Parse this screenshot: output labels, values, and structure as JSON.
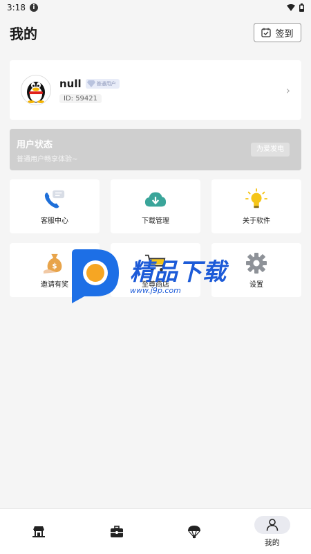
{
  "status_bar": {
    "time": "3:18"
  },
  "header": {
    "title": "我的",
    "signin_label": "签到"
  },
  "profile": {
    "username": "null",
    "badge": "普通用户",
    "user_id": "ID: 59421"
  },
  "status_banner": {
    "title": "用户状态",
    "subtitle": "普通用户畅享体验~",
    "button_label": "为爱发电"
  },
  "grid": {
    "items": [
      {
        "label": "客服中心",
        "icon": "phone-chat-icon"
      },
      {
        "label": "下载管理",
        "icon": "cloud-download-icon"
      },
      {
        "label": "关于软件",
        "icon": "lightbulb-icon"
      },
      {
        "label": "邀请有奖",
        "icon": "money-bag-icon"
      },
      {
        "label": "至尊商店",
        "icon": "shopping-cart-icon"
      },
      {
        "label": "设置",
        "icon": "gear-icon"
      }
    ]
  },
  "watermark": {
    "title": "精品下载",
    "url": "www.j9p.com"
  },
  "bottom_nav": {
    "items": [
      {
        "label": "",
        "icon": "home-stall-icon"
      },
      {
        "label": "",
        "icon": "toolbox-icon"
      },
      {
        "label": "",
        "icon": "parachute-icon"
      },
      {
        "label": "我的",
        "icon": "person-icon",
        "active": true
      }
    ]
  },
  "colors": {
    "accent_blue": "#1d5bd8",
    "banner_gray": "#cfcfcf",
    "cloud_teal": "#3aa59a",
    "bulb_yellow": "#f5c518"
  }
}
